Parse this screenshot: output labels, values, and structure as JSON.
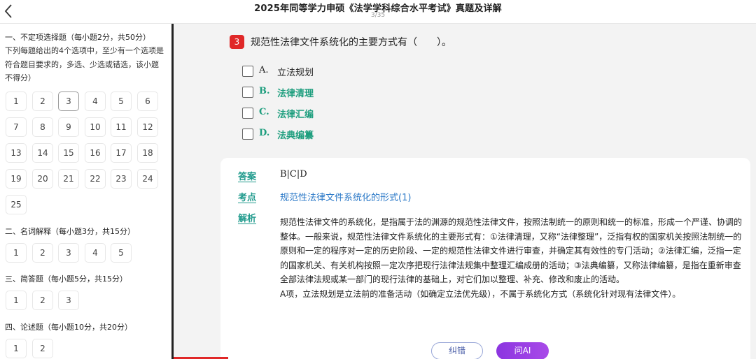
{
  "header": {
    "title": "2025年同等学力申硕《法学学科综合水平考试》真题及详解",
    "progress": "3/35",
    "back_icon": "chevron-left-icon"
  },
  "sidebar": {
    "sections": [
      {
        "title": "一、不定项选择题（每小题2分，共50分）",
        "description": "下列每题给出的4个选项中，至少有一个选项是符合题目要求的，多选、少选或错选，该小题不得分）",
        "questions": [
          "1",
          "2",
          "3",
          "4",
          "5",
          "6",
          "7",
          "8",
          "9",
          "10",
          "11",
          "12",
          "13",
          "14",
          "15",
          "16",
          "17",
          "18",
          "19",
          "20",
          "21",
          "22",
          "23",
          "24",
          "25"
        ]
      },
      {
        "title": "二、名词解释（每小题3分，共15分）",
        "questions": [
          "1",
          "2",
          "3",
          "4",
          "5"
        ]
      },
      {
        "title": "三、简答题（每小题5分，共15分）",
        "questions": [
          "1",
          "2",
          "3"
        ]
      },
      {
        "title": "四、论述题（每小题10分，共20分）",
        "questions": [
          "1",
          "2"
        ]
      }
    ],
    "current_question": "3"
  },
  "question": {
    "number": "3",
    "text": "规范性法律文件系统化的主要方式有（　　）。",
    "options": [
      {
        "key": "A.",
        "text": "立法规划",
        "correct": false
      },
      {
        "key": "B.",
        "text": "法律清理",
        "correct": true
      },
      {
        "key": "C.",
        "text": "法律汇编",
        "correct": true
      },
      {
        "key": "D.",
        "text": "法典编纂",
        "correct": true
      }
    ]
  },
  "answer": {
    "answer_label": "答案",
    "answer_value": "B|C|D",
    "point_label": "考点",
    "point_value": "规范性法律文件系统化的形式(1)",
    "analysis_label": "解析",
    "analysis_p1": "规范性法律文件的系统化，是指属于法的渊源的规范性法律文件，按照法制统一的原则和统一的标准，形成一个严谨、协调的整体。一般来说，规范性法律文件系统化的主要形式有：①法律清理，又称“法律整理”，泛指有权的国家机关按照法制统一的原则和一定的程序对一定的历史阶段、一定的规范性法律文件进行审查，并确定其有效性的专门活动；②法律汇编，泛指一定的国家机关、有关机构按照一定次序把现行法律法规集中整理汇编成册的活动；③法典编纂，又称法律编纂，是指在重新审查全部法律法规或某一部门的现行法律的基础上，对它们加以整理、补充、修改和废止的活动。",
    "analysis_p2": "A项，立法规划是立法前的准备活动（如确定立法优先级），不属于系统化方式（系统化针对现有法律文件）。",
    "correct_button": "纠错",
    "ai_button": "问AI"
  },
  "colors": {
    "accent_red": "#e02828",
    "correct_green": "#1e9e7e",
    "link_blue": "#2a78c7",
    "ai_purple": "#9a40e6"
  }
}
